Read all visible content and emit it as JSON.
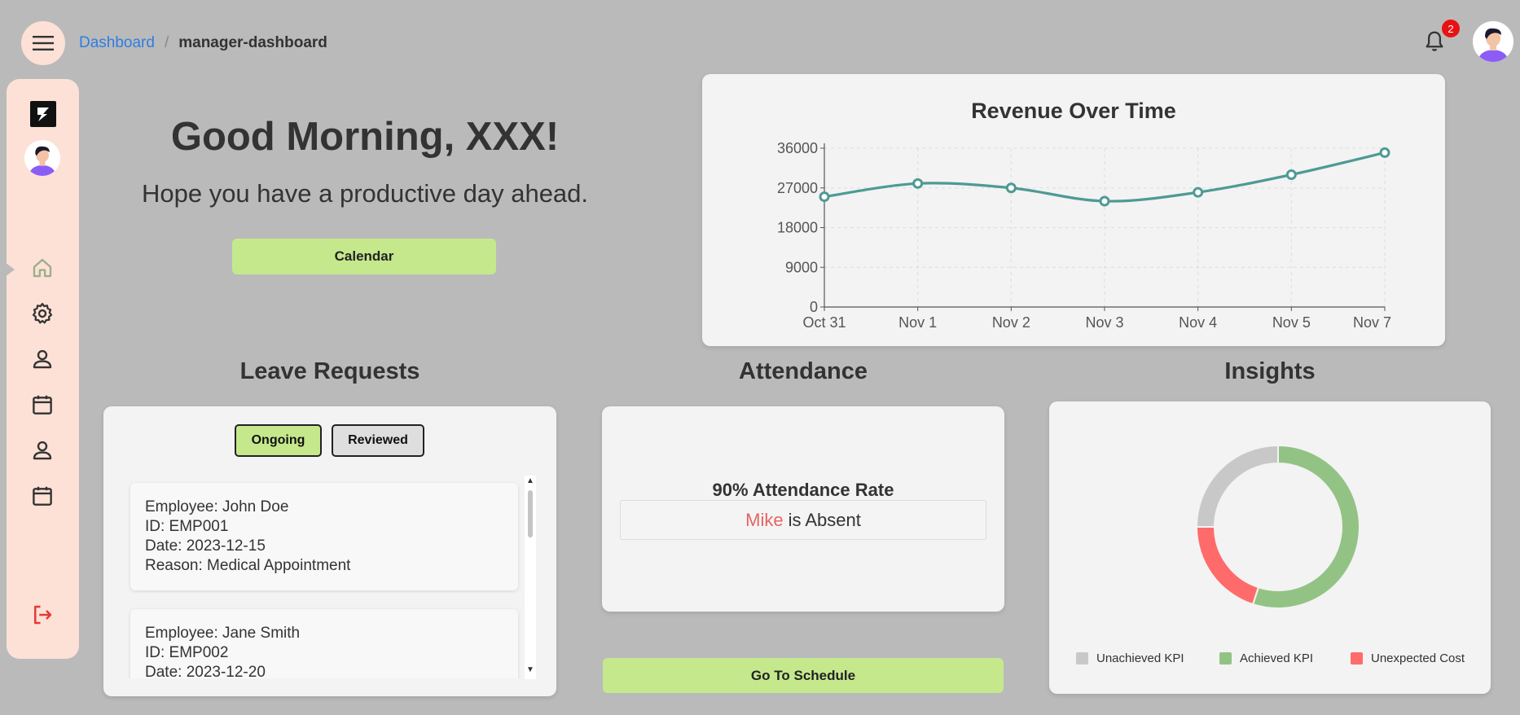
{
  "breadcrumb": {
    "home": "Dashboard",
    "separator": "/",
    "current": "manager-dashboard"
  },
  "notifications": {
    "count": "2"
  },
  "greeting": {
    "title": "Good Morning, XXX!",
    "subtitle": "Hope you have a productive day ahead.",
    "calendar_button": "Calendar"
  },
  "sidebar": {
    "items": [
      {
        "name": "home-icon",
        "active": true
      },
      {
        "name": "gear-icon"
      },
      {
        "name": "user-icon"
      },
      {
        "name": "calendar-icon"
      },
      {
        "name": "user-icon"
      },
      {
        "name": "calendar-icon"
      }
    ],
    "logout": "logout-icon"
  },
  "chart_data": {
    "type": "line",
    "title": "Revenue Over Time",
    "categories": [
      "Oct 31",
      "Nov 1",
      "Nov 2",
      "Nov 3",
      "Nov 4",
      "Nov 5",
      "Nov 7"
    ],
    "values": [
      25000,
      28000,
      27000,
      24000,
      26000,
      30000,
      35000
    ],
    "yticks": [
      "36000",
      "27000",
      "18000",
      "9000",
      "0"
    ],
    "ylim": [
      0,
      36000
    ],
    "grid": true,
    "line_color": "#4e9a94"
  },
  "leave": {
    "title": "Leave Requests",
    "tabs": {
      "ongoing": "Ongoing",
      "reviewed": "Reviewed"
    },
    "items": [
      {
        "employee": "Employee: John Doe",
        "id": "ID: EMP001",
        "date": "Date: 2023-12-15",
        "reason": "Reason: Medical Appointment"
      },
      {
        "employee": "Employee: Jane Smith",
        "id": "ID: EMP002",
        "date": "Date: 2023-12-20",
        "reason": ""
      }
    ]
  },
  "attendance": {
    "title": "Attendance",
    "rate": "90% Attendance Rate",
    "absent_name": "Mike",
    "absent_text": "is Absent",
    "schedule_button": "Go To Schedule"
  },
  "insights": {
    "title": "Insights",
    "segments": [
      {
        "label": "Unachieved KPI",
        "value": 25,
        "color": "#c8c8c8"
      },
      {
        "label": "Achieved KPI",
        "value": 55,
        "color": "#93c384"
      },
      {
        "label": "Unexpected Cost",
        "value": 20,
        "color": "#ff6b6b"
      }
    ]
  },
  "colors": {
    "accent": "#c5e88d",
    "sidebar_bg": "#fde1d6",
    "link": "#2f7de1",
    "absent": "#e76464"
  }
}
